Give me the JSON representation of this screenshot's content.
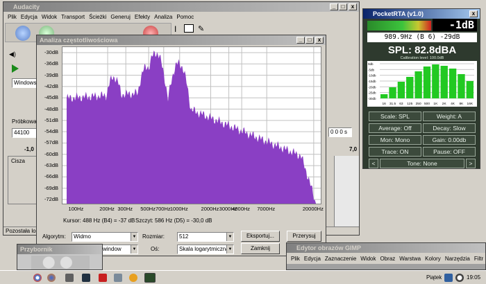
{
  "audacity": {
    "title": "Audacity",
    "menu": [
      "Plik",
      "Edycja",
      "Widok",
      "Transport",
      "Ścieżki",
      "Generuj",
      "Efekty",
      "Analiza",
      "Pomoc"
    ],
    "device": "Windows D",
    "rate_label": "Próbkowa",
    "rate_value": "44100",
    "tick_left": "-1,0",
    "tick_right": "7,0",
    "track_label": "Cisza",
    "status": "Pozostała los",
    "time_suffix": "0 0 0 s"
  },
  "analysis": {
    "title": "Analiza częstotliwościowa",
    "y_ticks": [
      "-30dB",
      "-36dB",
      "-39dB",
      "-42dB",
      "-45dB",
      "-48dB",
      "-51dB",
      "-54dB",
      "-57dB",
      "-60dB",
      "-63dB",
      "-66dB",
      "-69dB",
      "-72dB"
    ],
    "x_ticks": [
      "100Hz",
      "200Hz",
      "300Hz",
      "500Hz",
      "700Hz",
      "1000Hz",
      "2000Hz",
      "3000Hz",
      "4000Hz",
      "7000Hz",
      "20000Hz"
    ],
    "cursor_text": "Kursor: 488 Hz (B4) = -37 dB",
    "peak_text": "Szczyt: 586 Hz (D5) = -30,0 dB",
    "algorithm_label": "Algorytm:",
    "algorithm_value": "Widmo",
    "size_label": "Rozmiar:",
    "size_value": "512",
    "function_value": "window",
    "axis_label": "Oś:",
    "axis_value": "Skala logarytmiczna",
    "export_label": "Eksportuj...",
    "redraw_label": "Przerysuj",
    "close_label": "Zamknij",
    "fill_color": "#8a3fc4"
  },
  "pocketrta": {
    "title": "PocketRTA (v1.0)",
    "level": "-1dB",
    "freq_line": "989.9Hz (B 6) -29dB",
    "spl_text": "SPL: 82.8dBA",
    "cal_text": "Calibration level: 100.0dB",
    "y_ticks": [
      "0db",
      "-5db",
      "-10db",
      "-15db",
      "-20db",
      "-25db",
      "-30db"
    ],
    "bands": [
      "16",
      "31.5",
      "63",
      "125",
      "250",
      "500",
      "1K",
      "2K",
      "4K",
      "8K",
      "16K"
    ],
    "band_levels": [
      0.12,
      0.32,
      0.48,
      0.62,
      0.78,
      0.92,
      0.98,
      0.94,
      0.86,
      0.7,
      0.5
    ],
    "buttons": [
      "Scale: SPL",
      "Weight: A",
      "Average: Off",
      "Decay: Slow",
      "Mon: Mono",
      "Gain: 0.00db",
      "Trace: ON",
      "Pause: OFF"
    ],
    "tone": "Tone: None",
    "bar_color": "#22c922"
  },
  "toolbox": {
    "title": "Przybornik"
  },
  "gimp": {
    "title": "Edytor obrazów GIMP",
    "menu": [
      "Plik",
      "Edycja",
      "Zaznaczenie",
      "Widok",
      "Obraz",
      "Warstwa",
      "Kolory",
      "Narzędzia",
      "Filtr"
    ]
  },
  "taskbar": {
    "day": "Piątek",
    "time": "19:05"
  }
}
